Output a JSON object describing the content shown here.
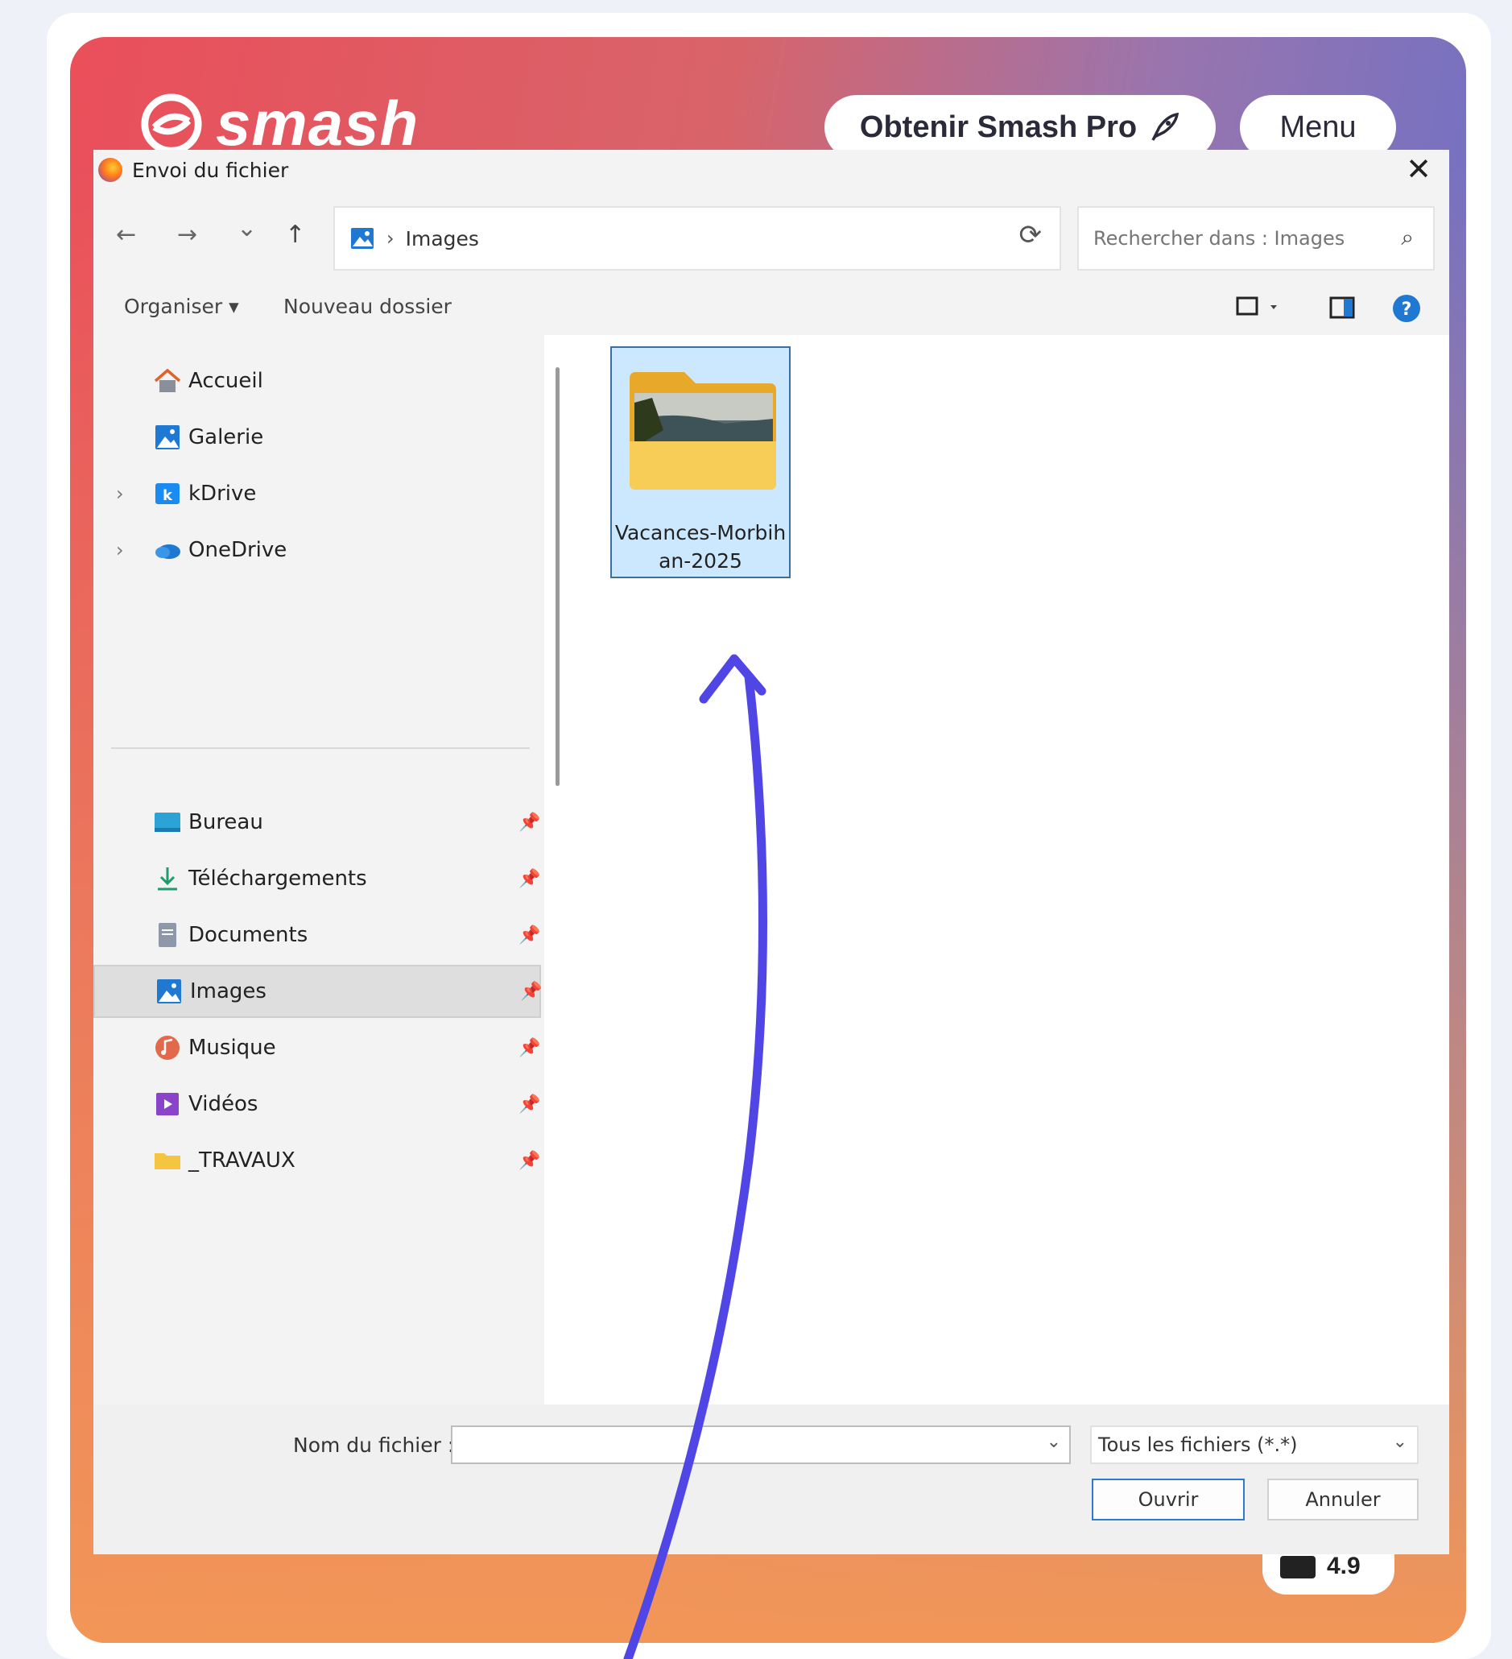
{
  "brand": {
    "name": "smash"
  },
  "header": {
    "pro_label": "Obtenir Smash Pro",
    "menu_label": "Menu",
    "rating_text": "4.9"
  },
  "dialog": {
    "title": "Envoi du fichier",
    "close_symbol": "✕",
    "nav": {
      "back": "←",
      "forward": "→",
      "recent": "⌄",
      "up": "↑"
    },
    "address": {
      "separator": "›",
      "path": "Images",
      "refresh": "⟳"
    },
    "search": {
      "placeholder": "Rechercher dans : Images",
      "icon": "⌕"
    },
    "commands": {
      "organize": "Organiser ▾",
      "new_folder": "Nouveau dossier"
    },
    "sidebar": {
      "top_items": [
        {
          "label": "Accueil",
          "icon": "home-icon",
          "expandable": false
        },
        {
          "label": "Galerie",
          "icon": "gallery-icon",
          "expandable": false
        },
        {
          "label": "kDrive",
          "icon": "kdrive-icon",
          "expandable": true
        },
        {
          "label": "OneDrive",
          "icon": "onedrive-icon",
          "expandable": true
        }
      ],
      "pinned_items": [
        {
          "label": "Bureau",
          "icon": "desktop-icon"
        },
        {
          "label": "Téléchargements",
          "icon": "download-icon"
        },
        {
          "label": "Documents",
          "icon": "documents-icon"
        },
        {
          "label": "Images",
          "icon": "pictures-icon",
          "selected": true
        },
        {
          "label": "Musique",
          "icon": "music-icon"
        },
        {
          "label": "Vidéos",
          "icon": "videos-icon"
        },
        {
          "label": "_TRAVAUX",
          "icon": "folder-icon"
        }
      ]
    },
    "main": {
      "folders": [
        {
          "name_line1": "Vacances-Morbih",
          "name_line2": "an-2025",
          "selected": true
        }
      ]
    },
    "footer": {
      "filename_label": "Nom du fichier :",
      "filename_value": "",
      "filter_value": "Tous les fichiers (*.*)",
      "open_label": "Ouvrir",
      "cancel_label": "Annuler"
    }
  },
  "colors": {
    "accent_arrow": "#4f46e5",
    "selection": "#cce8ff",
    "brand_red": "#ea4f5a",
    "brand_blue": "#5b6ed1"
  }
}
